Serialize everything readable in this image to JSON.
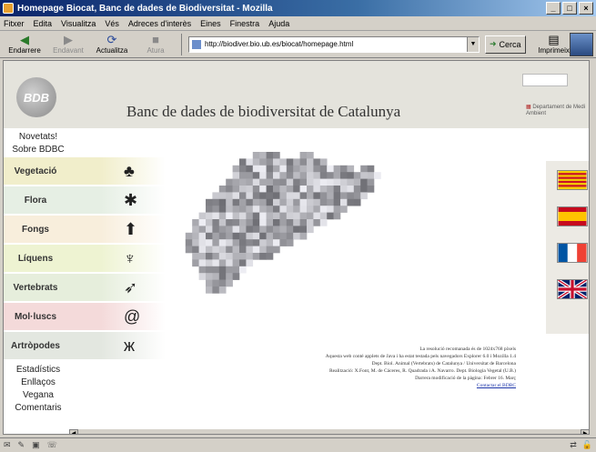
{
  "window": {
    "title": "Homepage Biocat, Banc de dades de Biodiversitat - Mozilla",
    "buttons": [
      "_",
      "□",
      "×"
    ]
  },
  "menu": [
    "Fitxer",
    "Edita",
    "Visualitza",
    "Vés",
    "Adreces d'interès",
    "Eines",
    "Finestra",
    "Ajuda"
  ],
  "toolbar": {
    "back": "Endarrere",
    "forward": "Endavant",
    "reload": "Actualitza",
    "stop": "Atura",
    "url": "http://biodiver.bio.ub.es/biocat/homepage.html",
    "search": "Cerca",
    "print": "Imprimeix"
  },
  "site": {
    "logo_text": "BDB",
    "title": "Banc de dades de biodiversitat de Catalunya",
    "department": "Departament de Medi Ambient",
    "nav_top": [
      "Novetats!",
      "Sobre BDBC"
    ],
    "categories": [
      {
        "label": "Vegetació",
        "icon": "tree-icon",
        "glyph": "♣",
        "color": "#f1eecb"
      },
      {
        "label": "Flora",
        "icon": "flower-icon",
        "glyph": "✱",
        "color": "#e6efe4"
      },
      {
        "label": "Fongs",
        "icon": "mushroom-icon",
        "glyph": "⬆",
        "color": "#f8eedc"
      },
      {
        "label": "Líquens",
        "icon": "lichen-icon",
        "glyph": "♆",
        "color": "#eef3d2"
      },
      {
        "label": "Vertebrats",
        "icon": "bird-icon",
        "glyph": "➶",
        "color": "#e6eedc"
      },
      {
        "label": "Mol·luscs",
        "icon": "snail-icon",
        "glyph": "@",
        "color": "#f4dada"
      },
      {
        "label": "Artròpodes",
        "icon": "butterfly-icon",
        "glyph": "ж",
        "color": "#e3e7e0"
      }
    ],
    "nav_bottom": [
      "Estadístics",
      "Enllaços",
      "Vegana",
      "Comentaris"
    ],
    "languages": [
      {
        "name": "catalan-flag-icon"
      },
      {
        "name": "spanish-flag-icon"
      },
      {
        "name": "french-flag-icon"
      },
      {
        "name": "uk-flag-icon"
      }
    ],
    "footer": [
      "La resolució recomanada és de 1024x768 píxels",
      "Aquesta web conté applets de Java i ha estat testada pels navegadors Explorer 6.0 i Mozilla 1.4",
      "Dept. Biol. Animal (Vertebrats) de Catalunya / Universitat de Barcelona",
      "Realització: X.Font, M. de Cáceres, R. Quadrada i A. Navarro. Dept. Biologia Vegetal (U.B.)",
      "Darrera modificació de la pàgina: Febrer 16. Març"
    ],
    "footer_link": "Contactar el BDBC"
  }
}
